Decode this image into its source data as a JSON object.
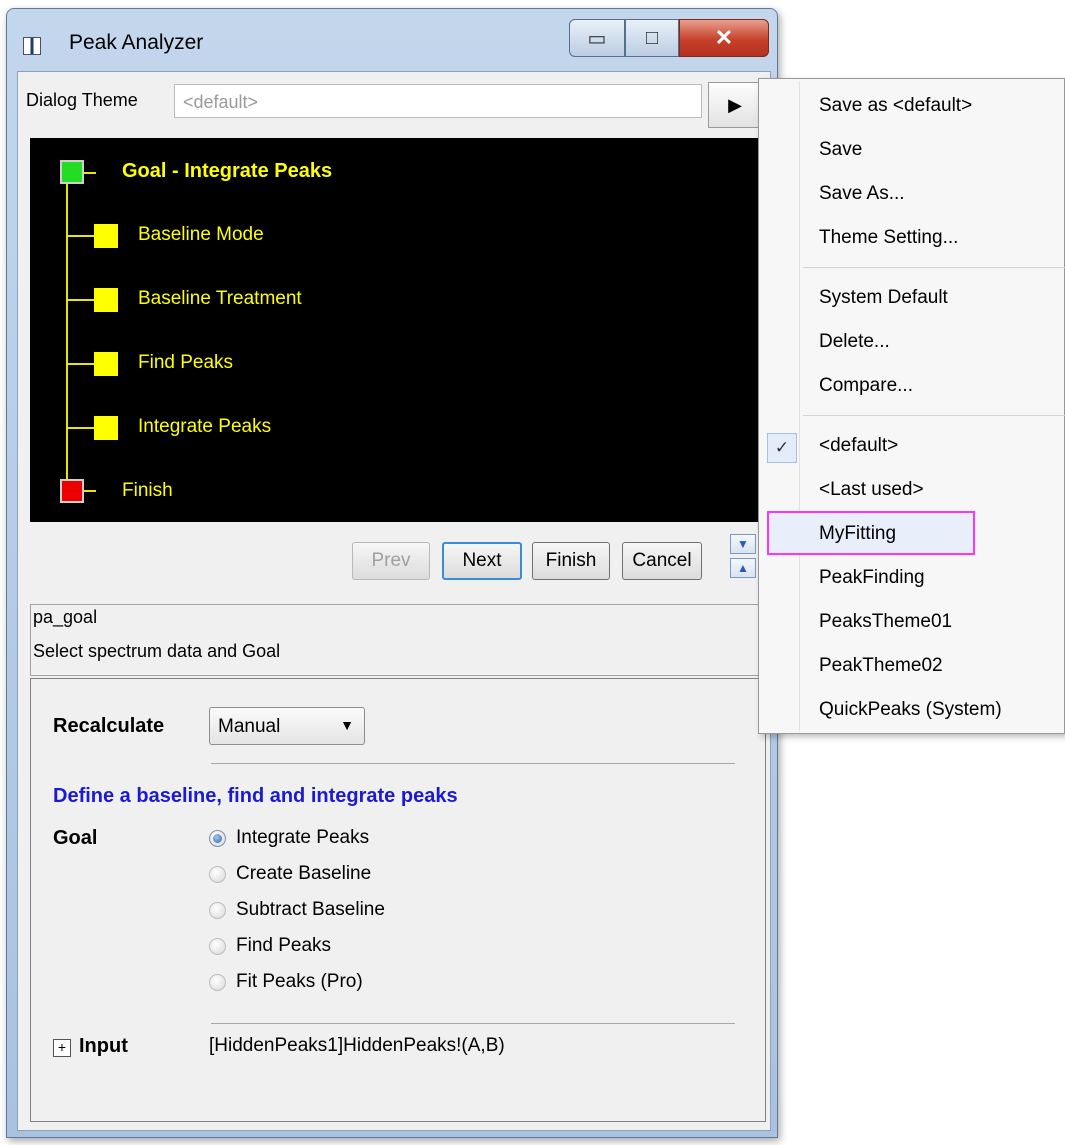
{
  "window": {
    "title": "Peak Analyzer",
    "min_glyph": "▭",
    "max_glyph": "□",
    "close_glyph": "✕"
  },
  "theme": {
    "label": "Dialog Theme",
    "value": "<default>",
    "arrow": "▶"
  },
  "tree": {
    "goal": "Goal - Integrate Peaks",
    "steps": [
      "Baseline Mode",
      "Baseline Treatment",
      "Find Peaks",
      "Integrate Peaks"
    ],
    "finish": "Finish"
  },
  "nav": {
    "prev": "Prev",
    "next": "Next",
    "finish": "Finish",
    "cancel": "Cancel",
    "down_glyph": "▼",
    "up_glyph": "▲"
  },
  "info": {
    "name": "pa_goal",
    "description": "Select spectrum data and Goal"
  },
  "settings": {
    "recalculate_label": "Recalculate",
    "recalculate_value": "Manual",
    "caret": "▼",
    "heading": "Define a baseline, find and integrate peaks",
    "goal_label": "Goal",
    "goal_options": [
      "Integrate Peaks",
      "Create Baseline",
      "Subtract Baseline",
      "Find Peaks",
      "Fit Peaks (Pro)"
    ],
    "goal_selected": "Integrate Peaks",
    "input_expander": "+",
    "input_label": "Input",
    "input_value": "[HiddenPeaks1]HiddenPeaks!(A,B)"
  },
  "menu": {
    "group1": [
      "Save as <default>",
      "Save",
      "Save As...",
      "Theme Setting..."
    ],
    "group2": [
      "System Default",
      "Delete...",
      "Compare..."
    ],
    "group3": [
      "<default>",
      "<Last used>",
      "MyFitting",
      "PeakFinding",
      "PeaksTheme01",
      "PeakTheme02",
      "QuickPeaks (System)"
    ],
    "checked": "<default>",
    "highlighted": "MyFitting",
    "check_glyph": "✓"
  },
  "colors": {
    "tree_bg": "#000000",
    "tree_text": "#ffff00",
    "heading_blue": "#1a1ad6",
    "highlight_border": "#ff33ff"
  }
}
